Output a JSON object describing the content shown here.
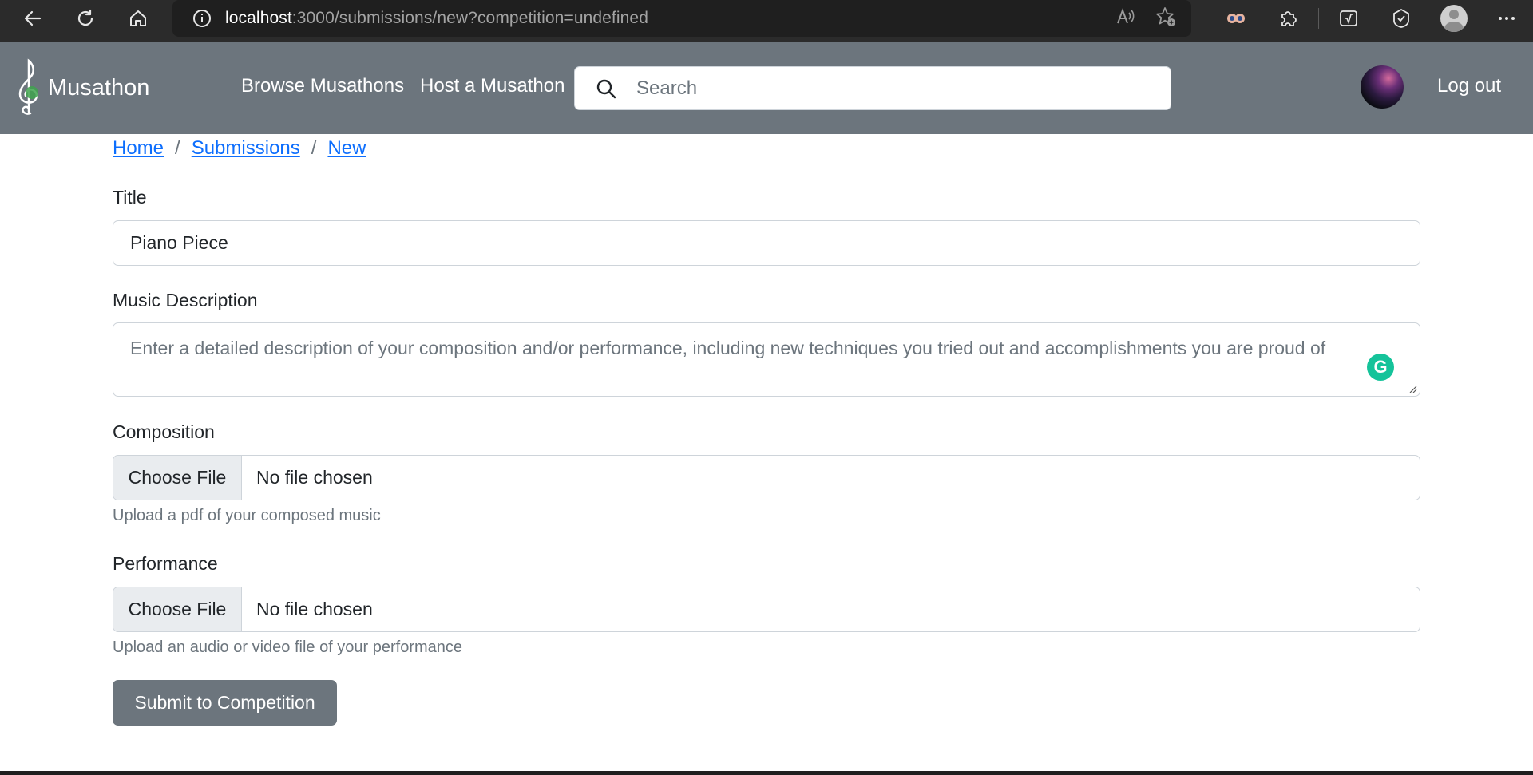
{
  "browser": {
    "url_host": "localhost",
    "url_rest": ":3000/submissions/new?competition=undefined"
  },
  "navbar": {
    "brand": "Musathon",
    "links": [
      "Browse Musathons",
      "Host a Musathon"
    ],
    "search_placeholder": "Search",
    "logout": "Log out"
  },
  "breadcrumb": [
    "Home",
    "Submissions",
    "New"
  ],
  "form": {
    "title_label": "Title",
    "title_value": "Piano Piece",
    "description_label": "Music Description",
    "description_placeholder": "Enter a detailed description of your composition and/or performance, including new techniques you tried out and accomplishments you are proud of",
    "composition_label": "Composition",
    "composition_button": "Choose File",
    "composition_status": "No file chosen",
    "composition_help": "Upload a pdf of your composed music",
    "performance_label": "Performance",
    "performance_button": "Choose File",
    "performance_status": "No file chosen",
    "performance_help": "Upload an audio or video file of your performance",
    "submit_label": "Submit to Competition"
  },
  "colors": {
    "navbar": "#6c757d",
    "link": "#0d6efd",
    "submit": "#6c757d",
    "grammarly": "#15c39a"
  }
}
